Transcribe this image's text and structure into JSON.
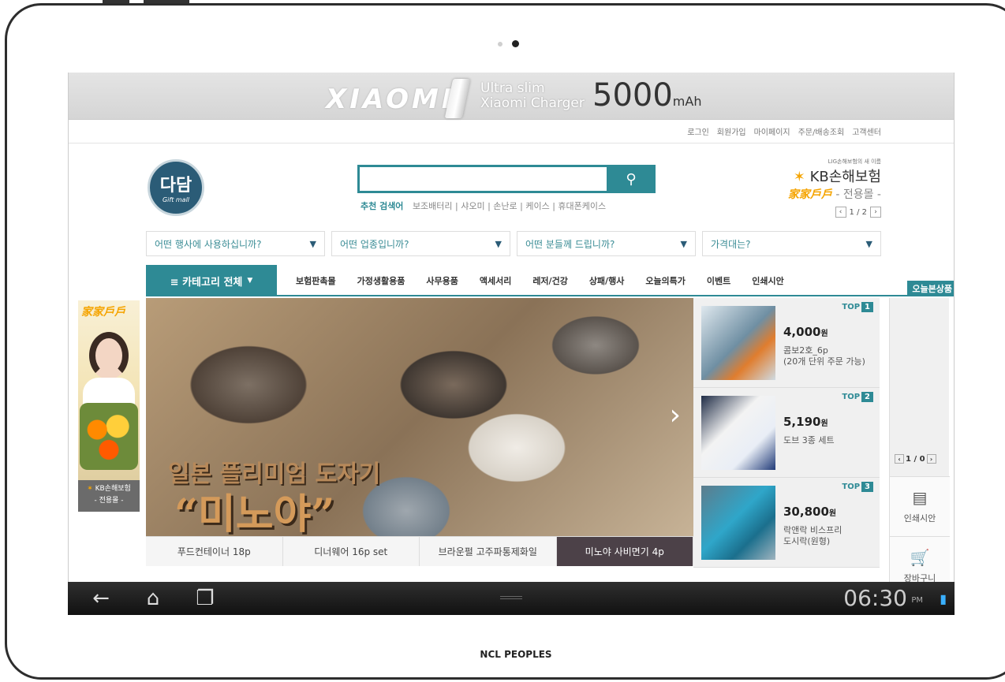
{
  "launcher": {
    "footer_caption": "NCL PEOPLES"
  },
  "promo": {
    "brand": "XIAOMI",
    "line1": "Ultra slim",
    "line2": "Xiaomi Charger",
    "capacity": "5000",
    "capacity_unit": "mAh"
  },
  "utility_links": [
    "로그인",
    "회원가입",
    "마이페이지",
    "주문/배송조회",
    "고객센터"
  ],
  "logo": {
    "text": "다담",
    "subtext": "Gift mall"
  },
  "search": {
    "value": "",
    "button_icon": "search-icon",
    "keywords_title": "추천 검색어",
    "keywords": "보조배터리 | 샤오미 | 손난로 | 케이스 | 휴대폰케이스"
  },
  "kb_banner": {
    "tagline": "LIG손해보험의 새 이름",
    "name": "KB손해보험",
    "subtitle_brand": "家家戶戶",
    "subtitle": "- 전용몰 -",
    "page": "1 / 2"
  },
  "filters": [
    "어떤 행사에 사용하십니까?",
    "어떤 업종입니까?",
    "어떤 분들께 드립니까?",
    "가격대는?"
  ],
  "nav": {
    "category_all": "≡ 카테고리 전체",
    "items": [
      "보험판촉몰",
      "가정생활용품",
      "사무용품",
      "액세서리",
      "레저/건강",
      "상패/행사",
      "오늘의특가",
      "이벤트",
      "인쇄시안"
    ],
    "today_tag": "오늘본상품"
  },
  "left_ad": {
    "brand": "家家戶戶",
    "footer_line1": "KB손해보험",
    "footer_line2": "- 전용몰 -"
  },
  "hero": {
    "headline1": "일본 플리미엄 도자기",
    "headline2": "“미노야”",
    "tabs": [
      "푸드컨테이너 18p",
      "디너웨어 16p set",
      "브라운펄 고주파통제화일",
      "미노야 사비면기 4p"
    ],
    "active_tab": 3
  },
  "top_items": [
    {
      "rank_label": "TOP",
      "rank": "1",
      "price": "4,000",
      "unit": "원",
      "desc1": "콤보2호_6p",
      "desc2": "(20개 단위 주문 가능)"
    },
    {
      "rank_label": "TOP",
      "rank": "2",
      "price": "5,190",
      "unit": "원",
      "desc1": "도브 3종 세트",
      "desc2": ""
    },
    {
      "rank_label": "TOP",
      "rank": "3",
      "price": "30,800",
      "unit": "원",
      "desc1": "락앤락 비스프리",
      "desc2": "도시락(원형)"
    }
  ],
  "right_side": {
    "page": "1 / 0",
    "quick1": "인쇄시안",
    "quick2": "장바구니"
  },
  "status_bar": {
    "time": "06:30",
    "ampm": "PM"
  },
  "colors": {
    "accent": "#2e8a95",
    "brand_orange": "#f5a400"
  }
}
